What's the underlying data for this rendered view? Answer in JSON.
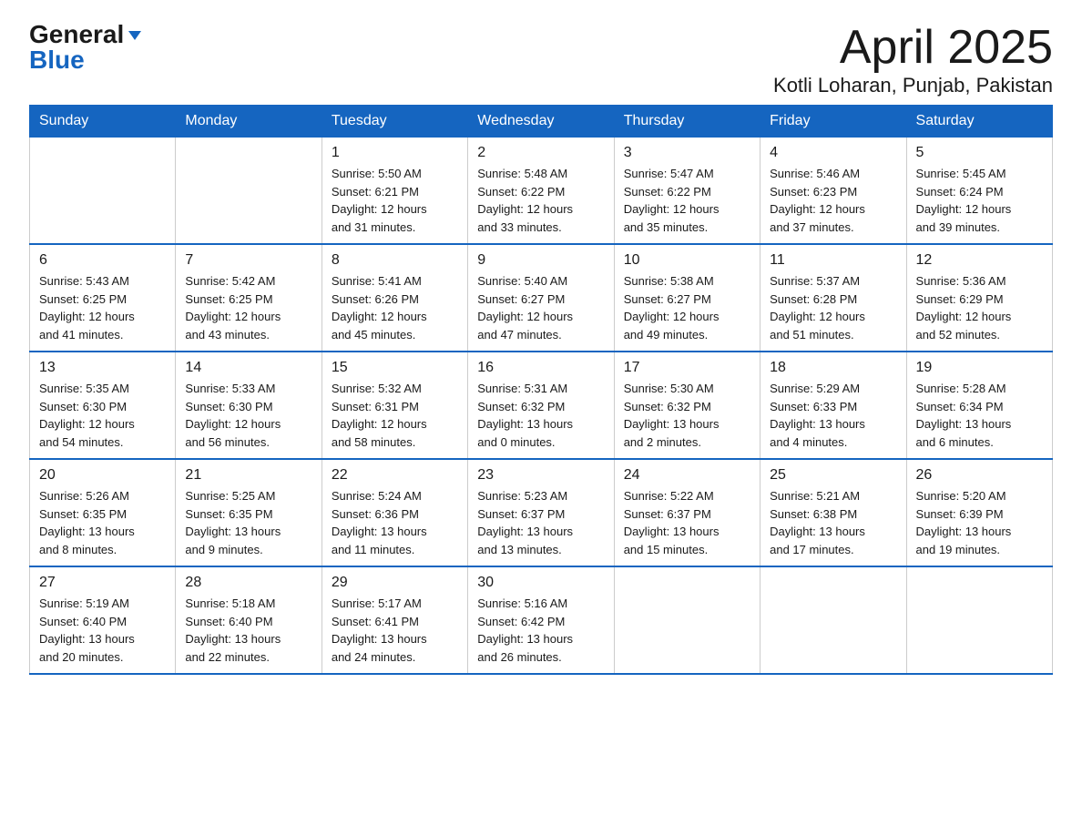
{
  "logo": {
    "general": "General",
    "blue": "Blue"
  },
  "title": {
    "main": "April 2025",
    "location": "Kotli Loharan, Punjab, Pakistan"
  },
  "calendar": {
    "headers": [
      "Sunday",
      "Monday",
      "Tuesday",
      "Wednesday",
      "Thursday",
      "Friday",
      "Saturday"
    ],
    "weeks": [
      [
        {
          "day": "",
          "info": ""
        },
        {
          "day": "",
          "info": ""
        },
        {
          "day": "1",
          "info": "Sunrise: 5:50 AM\nSunset: 6:21 PM\nDaylight: 12 hours\nand 31 minutes."
        },
        {
          "day": "2",
          "info": "Sunrise: 5:48 AM\nSunset: 6:22 PM\nDaylight: 12 hours\nand 33 minutes."
        },
        {
          "day": "3",
          "info": "Sunrise: 5:47 AM\nSunset: 6:22 PM\nDaylight: 12 hours\nand 35 minutes."
        },
        {
          "day": "4",
          "info": "Sunrise: 5:46 AM\nSunset: 6:23 PM\nDaylight: 12 hours\nand 37 minutes."
        },
        {
          "day": "5",
          "info": "Sunrise: 5:45 AM\nSunset: 6:24 PM\nDaylight: 12 hours\nand 39 minutes."
        }
      ],
      [
        {
          "day": "6",
          "info": "Sunrise: 5:43 AM\nSunset: 6:25 PM\nDaylight: 12 hours\nand 41 minutes."
        },
        {
          "day": "7",
          "info": "Sunrise: 5:42 AM\nSunset: 6:25 PM\nDaylight: 12 hours\nand 43 minutes."
        },
        {
          "day": "8",
          "info": "Sunrise: 5:41 AM\nSunset: 6:26 PM\nDaylight: 12 hours\nand 45 minutes."
        },
        {
          "day": "9",
          "info": "Sunrise: 5:40 AM\nSunset: 6:27 PM\nDaylight: 12 hours\nand 47 minutes."
        },
        {
          "day": "10",
          "info": "Sunrise: 5:38 AM\nSunset: 6:27 PM\nDaylight: 12 hours\nand 49 minutes."
        },
        {
          "day": "11",
          "info": "Sunrise: 5:37 AM\nSunset: 6:28 PM\nDaylight: 12 hours\nand 51 minutes."
        },
        {
          "day": "12",
          "info": "Sunrise: 5:36 AM\nSunset: 6:29 PM\nDaylight: 12 hours\nand 52 minutes."
        }
      ],
      [
        {
          "day": "13",
          "info": "Sunrise: 5:35 AM\nSunset: 6:30 PM\nDaylight: 12 hours\nand 54 minutes."
        },
        {
          "day": "14",
          "info": "Sunrise: 5:33 AM\nSunset: 6:30 PM\nDaylight: 12 hours\nand 56 minutes."
        },
        {
          "day": "15",
          "info": "Sunrise: 5:32 AM\nSunset: 6:31 PM\nDaylight: 12 hours\nand 58 minutes."
        },
        {
          "day": "16",
          "info": "Sunrise: 5:31 AM\nSunset: 6:32 PM\nDaylight: 13 hours\nand 0 minutes."
        },
        {
          "day": "17",
          "info": "Sunrise: 5:30 AM\nSunset: 6:32 PM\nDaylight: 13 hours\nand 2 minutes."
        },
        {
          "day": "18",
          "info": "Sunrise: 5:29 AM\nSunset: 6:33 PM\nDaylight: 13 hours\nand 4 minutes."
        },
        {
          "day": "19",
          "info": "Sunrise: 5:28 AM\nSunset: 6:34 PM\nDaylight: 13 hours\nand 6 minutes."
        }
      ],
      [
        {
          "day": "20",
          "info": "Sunrise: 5:26 AM\nSunset: 6:35 PM\nDaylight: 13 hours\nand 8 minutes."
        },
        {
          "day": "21",
          "info": "Sunrise: 5:25 AM\nSunset: 6:35 PM\nDaylight: 13 hours\nand 9 minutes."
        },
        {
          "day": "22",
          "info": "Sunrise: 5:24 AM\nSunset: 6:36 PM\nDaylight: 13 hours\nand 11 minutes."
        },
        {
          "day": "23",
          "info": "Sunrise: 5:23 AM\nSunset: 6:37 PM\nDaylight: 13 hours\nand 13 minutes."
        },
        {
          "day": "24",
          "info": "Sunrise: 5:22 AM\nSunset: 6:37 PM\nDaylight: 13 hours\nand 15 minutes."
        },
        {
          "day": "25",
          "info": "Sunrise: 5:21 AM\nSunset: 6:38 PM\nDaylight: 13 hours\nand 17 minutes."
        },
        {
          "day": "26",
          "info": "Sunrise: 5:20 AM\nSunset: 6:39 PM\nDaylight: 13 hours\nand 19 minutes."
        }
      ],
      [
        {
          "day": "27",
          "info": "Sunrise: 5:19 AM\nSunset: 6:40 PM\nDaylight: 13 hours\nand 20 minutes."
        },
        {
          "day": "28",
          "info": "Sunrise: 5:18 AM\nSunset: 6:40 PM\nDaylight: 13 hours\nand 22 minutes."
        },
        {
          "day": "29",
          "info": "Sunrise: 5:17 AM\nSunset: 6:41 PM\nDaylight: 13 hours\nand 24 minutes."
        },
        {
          "day": "30",
          "info": "Sunrise: 5:16 AM\nSunset: 6:42 PM\nDaylight: 13 hours\nand 26 minutes."
        },
        {
          "day": "",
          "info": ""
        },
        {
          "day": "",
          "info": ""
        },
        {
          "day": "",
          "info": ""
        }
      ]
    ]
  }
}
